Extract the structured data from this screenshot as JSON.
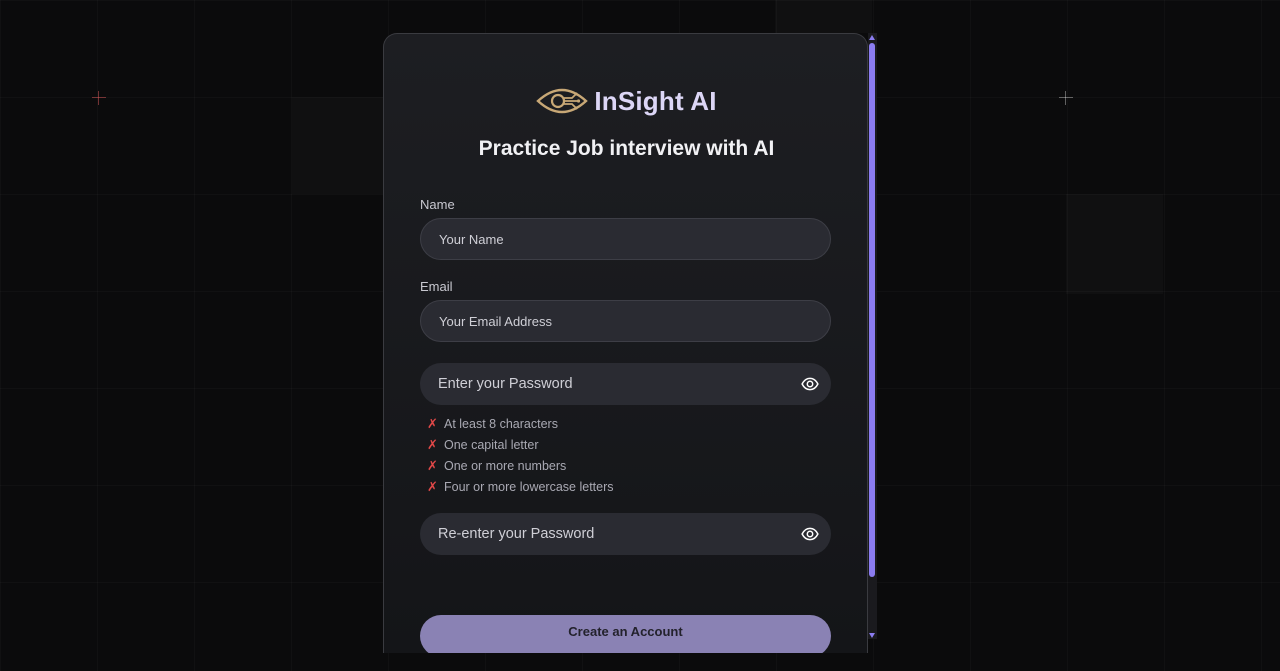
{
  "brand": {
    "name": "InSight AI",
    "accent_color": "#dcd6f6",
    "logo_icon": "eye-circuit-icon",
    "logo_color": "#c8a876"
  },
  "heading": "Practice Job interview with AI",
  "form": {
    "name": {
      "label": "Name",
      "placeholder": "Your Name",
      "value": ""
    },
    "email": {
      "label": "Email",
      "placeholder": "Your Email Address",
      "value": ""
    },
    "password": {
      "placeholder": "Enter your Password",
      "value": "",
      "toggle_icon": "eye-icon"
    },
    "password_rules": [
      {
        "status": "✗",
        "text": "At least 8 characters"
      },
      {
        "status": "✗",
        "text": "One capital letter"
      },
      {
        "status": "✗",
        "text": "One or more numbers"
      },
      {
        "status": "✗",
        "text": "Four or more lowercase letters"
      }
    ],
    "confirm_password": {
      "placeholder": "Re-enter your Password",
      "value": "",
      "toggle_icon": "eye-icon"
    },
    "submit_label": "Create an Account"
  },
  "colors": {
    "scrollbar_thumb": "#8b7cf0",
    "rule_fail": "#e04848",
    "submit_bg": "#8a82b4"
  }
}
